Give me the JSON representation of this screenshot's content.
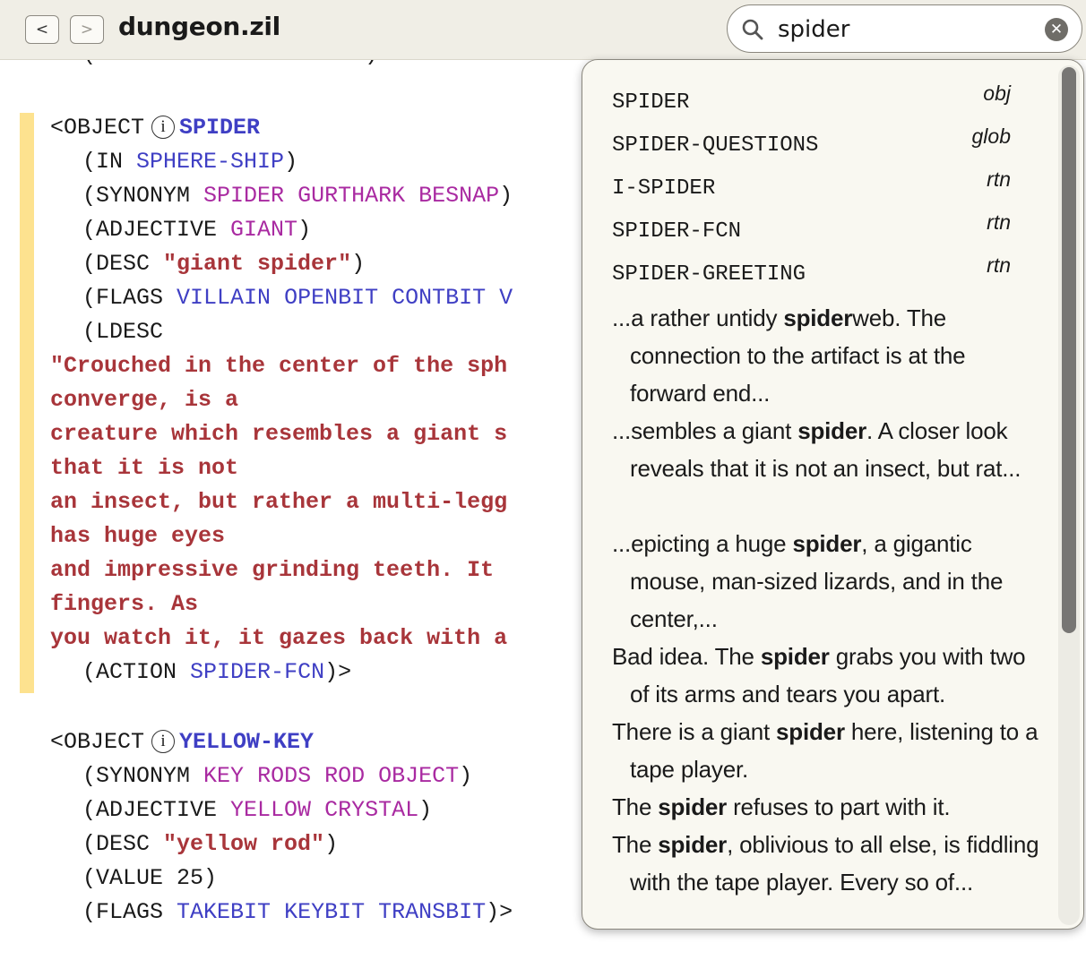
{
  "toolbar": {
    "back_label": "<",
    "forward_label": ">",
    "title": "dungeon.zil",
    "search_value": "spider"
  },
  "code": {
    "partial_line": "(FLAGS RLANDBIT ONBIT)>",
    "obj1": {
      "open": "<OBJECT",
      "name": "SPIDER",
      "in_label": "(IN",
      "in_value": "SPHERE-SHIP",
      "synonym_label": "(SYNONYM",
      "synonyms": [
        "SPIDER",
        "GURTHARK",
        "BESNAP"
      ],
      "adjective_label": "(ADJECTIVE",
      "adjective": "GIANT",
      "desc_label": "(DESC",
      "desc": "\"giant spider\"",
      "flags_label": "(FLAGS",
      "flags": [
        "VILLAIN",
        "OPENBIT",
        "CONTBIT",
        "V"
      ],
      "ldesc_label": "(LDESC",
      "ldesc_lines": [
        "\"Crouched in the center of the sph",
        "converge, is a",
        "creature which resembles a giant s",
        "that it is not",
        "an insect, but rather a multi-legg",
        "has huge eyes",
        "and impressive grinding teeth. It",
        "fingers. As",
        "you watch it, it gazes back with a"
      ],
      "action_label": "(ACTION",
      "action": "SPIDER-FCN"
    },
    "obj2": {
      "open": "<OBJECT",
      "name": "YELLOW-KEY",
      "synonym_label": "(SYNONYM",
      "synonyms": [
        "KEY",
        "RODS",
        "ROD",
        "OBJECT"
      ],
      "adjective_label": "(ADJECTIVE",
      "adjectives": [
        "YELLOW",
        "CRYSTAL"
      ],
      "desc_label": "(DESC",
      "desc": "\"yellow rod\"",
      "value_line": "(VALUE 25)",
      "flags_label": "(FLAGS",
      "flags": [
        "TAKEBIT",
        "KEYBIT",
        "TRANSBIT"
      ]
    }
  },
  "results": {
    "symbols": [
      {
        "name": "SPIDER",
        "kind": "obj"
      },
      {
        "name": "SPIDER-QUESTIONS",
        "kind": "glob"
      },
      {
        "name": "I-SPIDER",
        "kind": "rtn"
      },
      {
        "name": "SPIDER-FCN",
        "kind": "rtn"
      },
      {
        "name": "SPIDER-GREETING",
        "kind": "rtn"
      }
    ],
    "snippets": [
      {
        "pre": "...a rather untidy ",
        "match": "spider",
        "post": "web. The connection to the artifact is at the forward end..."
      },
      {
        "pre": "...sembles a giant ",
        "match": "spider",
        "post": ". A closer look reveals that it is not an insect, but rat..."
      },
      {
        "pre": "...epicting a huge ",
        "match": "spider",
        "post": ", a gigantic mouse, man-sized lizards, and in the center,..."
      },
      {
        "pre": "Bad idea. The ",
        "match": "spider",
        "post": " grabs you with two of its arms and tears you apart."
      },
      {
        "pre": "There is a giant ",
        "match": "spider",
        "post": " here, listening to a tape player."
      },
      {
        "pre": "The ",
        "match": "spider",
        "post": " refuses to part with it."
      },
      {
        "pre": "The ",
        "match": "spider",
        "post": ", oblivious to all else, is fiddling with the tape player. Every so of..."
      }
    ]
  },
  "colors": {
    "toolbar_bg": "#f0eee6",
    "identifier": "#3f3fc4",
    "synonym": "#a92aa1",
    "string": "#a8353a",
    "margin_highlight": "#fde28f",
    "popup_bg": "#f9f8f1"
  },
  "icons": [
    "chevron-left-icon",
    "chevron-right-icon",
    "search-icon",
    "clear-icon",
    "info-icon"
  ]
}
